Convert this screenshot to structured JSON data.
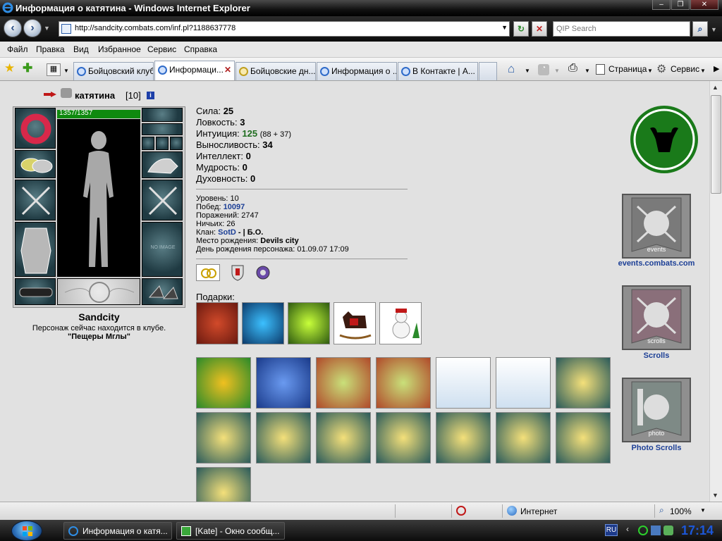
{
  "window": {
    "title": "Информация о катятина - Windows Internet Explorer"
  },
  "address": {
    "url": "http://sandcity.combats.com/inf.pl?1188637778",
    "search_placeholder": "QIP Search"
  },
  "menu": [
    "Файл",
    "Правка",
    "Вид",
    "Избранное",
    "Сервис",
    "Справка"
  ],
  "tabs": [
    {
      "label": "Бойцовский клуб",
      "active": false
    },
    {
      "label": "Информаци...",
      "active": true
    },
    {
      "label": "Бойцовские дн...",
      "active": false
    },
    {
      "label": "Информация о ...",
      "active": false
    },
    {
      "label": "В Контакте | А...",
      "active": false
    }
  ],
  "toolbar": {
    "page_label": "Страница",
    "tools_label": "Сервис"
  },
  "character": {
    "name": "катятина",
    "level_tag": "[10]",
    "hp": "1357/1357",
    "hp_fraction": 1.0,
    "no_image": "NO IMAGE",
    "city": "Sandcity",
    "location_line": "Персонаж сейчас находится в клубе.",
    "location_name": "\"Пещеры Мглы\""
  },
  "stats": [
    {
      "label": "Сила:",
      "value": "25",
      "extra": ""
    },
    {
      "label": "Ловкость:",
      "value": "3",
      "extra": ""
    },
    {
      "label": "Интуиция:",
      "value": "125",
      "extra": "(88 + 37)",
      "color": "#1f6d1f"
    },
    {
      "label": "Выносливость:",
      "value": "34",
      "extra": ""
    },
    {
      "label": "Интеллект:",
      "value": "0",
      "extra": ""
    },
    {
      "label": "Мудрость:",
      "value": "0",
      "extra": ""
    },
    {
      "label": "Духовность:",
      "value": "0",
      "extra": ""
    }
  ],
  "info": {
    "level": "Уровень: 10",
    "wins_label": "Побед:",
    "wins_value": "10097",
    "losses": "Поражений: 2747",
    "draws": "Ничьих: 26",
    "clan_label": "Клан:",
    "clan_value": "SotD",
    "clan_extra": "- | Б.О.",
    "birthplace_label": "Место рождения:",
    "birthplace_value": "Devils city",
    "birthday": "День рождения персонажа: 01.09.07 17:09"
  },
  "gifts_label": "Подарки:",
  "gifts_top": [
    "cloak-gift",
    "mushroom-gift",
    "gem-gift",
    "rocking-horse-gift",
    "snowman-gift"
  ],
  "gifts_grid_count": 15,
  "sidebar": {
    "events_link": "events.combats.com",
    "events_caption": "events",
    "scrolls_link": "Scrolls",
    "scrolls_caption": "scrolls",
    "photo_link": "Photo Scrolls",
    "photo_caption": "photo"
  },
  "status": {
    "zone": "Интернет",
    "zoom": "100%"
  },
  "taskbar": {
    "items": [
      "Информация о катя...",
      "[Kate] - Окно сообщ..."
    ],
    "lang": "RU",
    "time": "17:14"
  },
  "colors": {
    "hp_green": "#0f8a0f",
    "logo_green": "#1a7a1a",
    "link_blue": "#1c3f96"
  }
}
